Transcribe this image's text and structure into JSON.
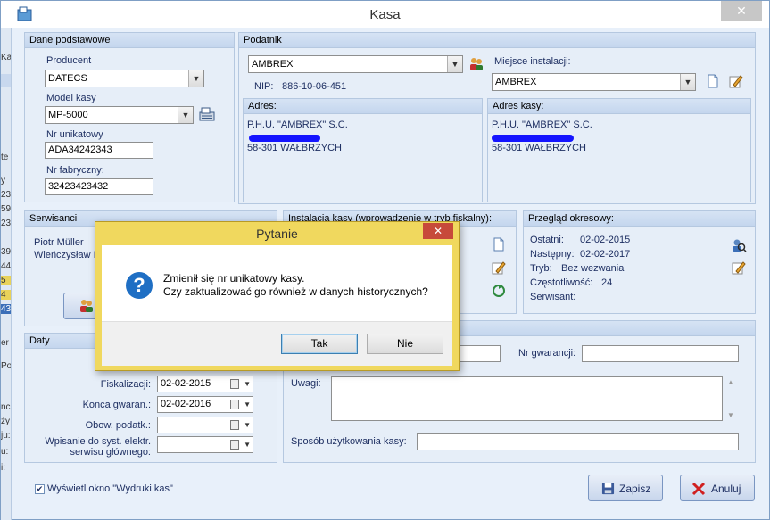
{
  "window": {
    "title": "Kasa",
    "close_glyph": "✕"
  },
  "left_strip": [
    {
      "text": "Ka"
    },
    {
      "text": "te"
    },
    {
      "text": "y"
    },
    {
      "text": "23"
    },
    {
      "text": "59"
    },
    {
      "text": "23"
    },
    {
      "text": "39"
    },
    {
      "text": "44"
    },
    {
      "text": "5"
    },
    {
      "text": "4"
    },
    {
      "text": "43"
    },
    {
      "text": "er"
    },
    {
      "text": "Po"
    },
    {
      "text": "nc"
    },
    {
      "text": "ży"
    },
    {
      "text": "ju:"
    },
    {
      "text": "u:"
    },
    {
      "text": "i:"
    }
  ],
  "dane": {
    "header": "Dane podstawowe",
    "producent_label": "Producent",
    "producent_value": "DATECS",
    "model_label": "Model kasy",
    "model_value": "MP-5000",
    "nr_unikatowy_label": "Nr unikatowy",
    "nr_unikatowy_value": "ADA34242343",
    "nr_fabryczny_label": "Nr fabryczny:",
    "nr_fabryczny_value": "32423423432"
  },
  "podatnik": {
    "header": "Podatnik",
    "name_value": "AMBREX",
    "nip_label": "NIP:",
    "nip_value": "886-10-06-451",
    "miejsce_label": "Miejsce instalacji:",
    "miejsce_value": "AMBREX",
    "adres_header": "Adres:",
    "adres_line1": "P.H.U. \"AMBREX\" S.C.",
    "adres_line3": "58-301 WAŁBRZYCH",
    "adres_kasy_header": "Adres kasy:",
    "adres_kasy_line1": "P.H.U. \"AMBREX\" S.C.",
    "adres_kasy_line3": "58-301 WAŁBRZYCH"
  },
  "serwisanci": {
    "header": "Serwisanci",
    "items": [
      "Piotr Müller",
      "Wieńczysław I"
    ]
  },
  "instalacja": {
    "header": "Instalacja kasy (wprowadzenie w tryb fiskalny):"
  },
  "przeglad": {
    "header": "Przegląd okresowy:",
    "ostatni_label": "Ostatni:",
    "ostatni_value": "02-02-2015",
    "nastepny_label": "Następny:",
    "nastepny_value": "02-02-2017",
    "tryb_label": "Tryb:",
    "tryb_value": "Bez wezwania",
    "czestotliwosc_label": "Częstotliwość:",
    "czestotliwosc_value": "24",
    "serwisant_label": "Serwisant:"
  },
  "daty": {
    "header": "Daty",
    "fiskalizacji_label": "Fiskalizacji:",
    "fiskalizacji_value": "02-02-2015",
    "konca_label": "Konca gwaran.:",
    "konca_value": "02-02-2016",
    "obow_label": "Obow. podatk.:",
    "obow_value": "",
    "wpisanie_label1": "Wpisanie do syst. elektr.",
    "wpisanie_label2": "serwisu głównego:",
    "wpisanie_value": ""
  },
  "inne": {
    "nr_gwarancji_label": "Nr gwarancji:",
    "uwagi_label": "Uwagi:",
    "sposob_label": "Sposób użytkowania kasy:"
  },
  "footer": {
    "wyswietl_label": "Wyświetl okno \"Wydruki kas\"",
    "zapisz_label": "Zapisz",
    "anuluj_label": "Anuluj"
  },
  "dialog": {
    "title": "Pytanie",
    "close_glyph": "✕",
    "line1": "Zmienił się nr unikatowy kasy.",
    "line2": "Czy zaktualizować go również w danych historycznych?",
    "tak_label": "Tak",
    "nie_label": "Nie"
  },
  "colors": {
    "accent": "#1f6fc4",
    "dialog_frame": "#f0d85e",
    "scribble": "#1414ff"
  }
}
